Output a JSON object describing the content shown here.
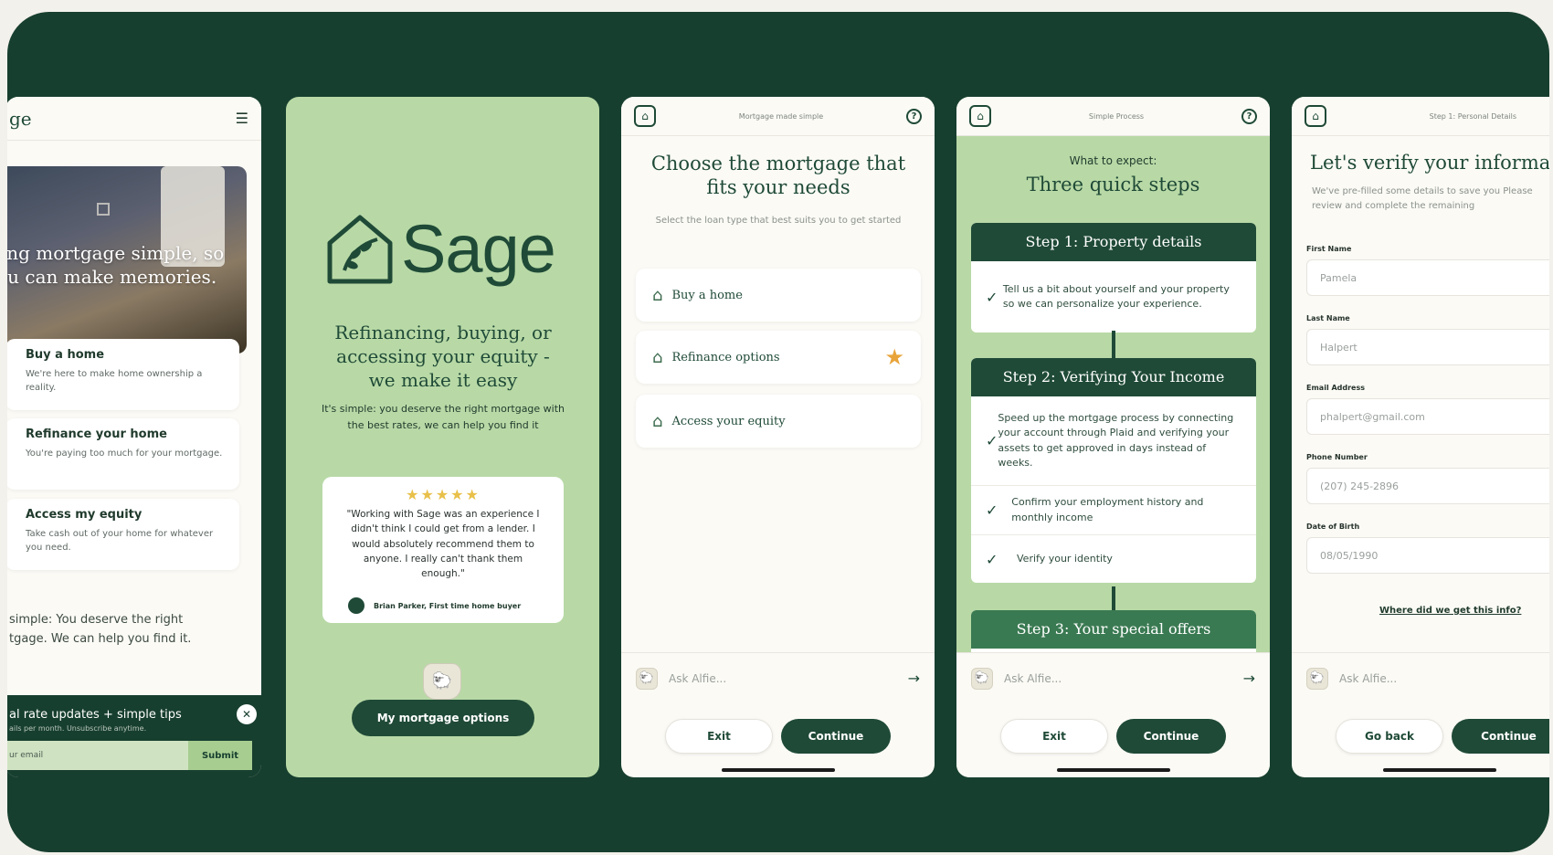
{
  "panel1": {
    "brand_partial": "ge",
    "menu_icon": "hamburger-icon",
    "hero_text": "aking mortgage simple, so you can make memories.",
    "cards": [
      {
        "title": "Buy a home",
        "desc": "We're here to make home ownership a reality."
      },
      {
        "title": "Refinance your home",
        "desc": "You're paying too much for your mortgage."
      },
      {
        "title": "Access my equity",
        "desc": "Take cash out of your home for whatever you need."
      }
    ],
    "body_text": "simple: You deserve the right tgage. We can help you find it.",
    "newsletter_title": "al rate updates + simple tips",
    "newsletter_sub": "ails per month. Unsubscribe anytime.",
    "email_placeholder": "ur email",
    "submit_label": "Submit"
  },
  "panel2": {
    "brand": "Sage",
    "headline": "Refinancing, buying, or accessing your equity - we make it easy",
    "sub": "It's simple: you deserve the right mortgage with the best rates, we can help you find it",
    "stars": "★★★★★",
    "quote": "\"Working with Sage was an experience I didn't think I could get from a lender. I would absolutely recommend them to anyone. I really can't thank them enough.\"",
    "author": "Brian Parker, First time home buyer",
    "cta": "My mortgage options"
  },
  "panel3": {
    "header_title": "Mortgage made simple",
    "title": "Choose the mortgage that fits your needs",
    "sub": "Select the loan type that best suits you to get started",
    "options": [
      {
        "label": "Buy a home"
      },
      {
        "label": "Refinance options"
      },
      {
        "label": "Access your equity"
      }
    ],
    "ask_placeholder": "Ask Alfie...",
    "exit": "Exit",
    "continue": "Continue"
  },
  "panel4": {
    "header_title": "Simple Process",
    "kicker": "What to expect:",
    "title": "Three quick steps",
    "step1": {
      "title": "Step 1: Property details",
      "items": [
        "Tell us a bit about yourself and your property so we can personalize your experience."
      ]
    },
    "step2": {
      "title": "Step 2: Verifying Your Income",
      "items": [
        "Speed up the mortgage process by connecting your account through Plaid and verifying your assets to get approved in days instead of weeks.",
        "Confirm your employment history and monthly income",
        "Verify your identity"
      ]
    },
    "step3": {
      "title": "Step 3: Your special offers"
    },
    "ask_placeholder": "Ask Alfie...",
    "exit": "Exit",
    "continue": "Continue"
  },
  "panel5": {
    "header_title": "Step 1: Personal Details",
    "title": "Let's verify your informa",
    "sub": "We've pre-filled some details to save you Please review and complete the remaining",
    "fields": [
      {
        "label": "First Name",
        "value": "Pamela"
      },
      {
        "label": "Last Name",
        "value": "Halpert"
      },
      {
        "label": "Email Address",
        "value": "phalpert@gmail.com"
      },
      {
        "label": "Phone Number",
        "value": "(207) 245-2896"
      },
      {
        "label": "Date of Birth",
        "value": "08/05/1990"
      }
    ],
    "info_link": "Where did we get this info?",
    "ask_placeholder": "Ask Alfie...",
    "back": "Go back",
    "continue": "Continue"
  },
  "colors": {
    "forest": "#173f2f",
    "brand": "#1f4a37",
    "sage": "#b8d9a6",
    "star": "#e8a43a"
  }
}
